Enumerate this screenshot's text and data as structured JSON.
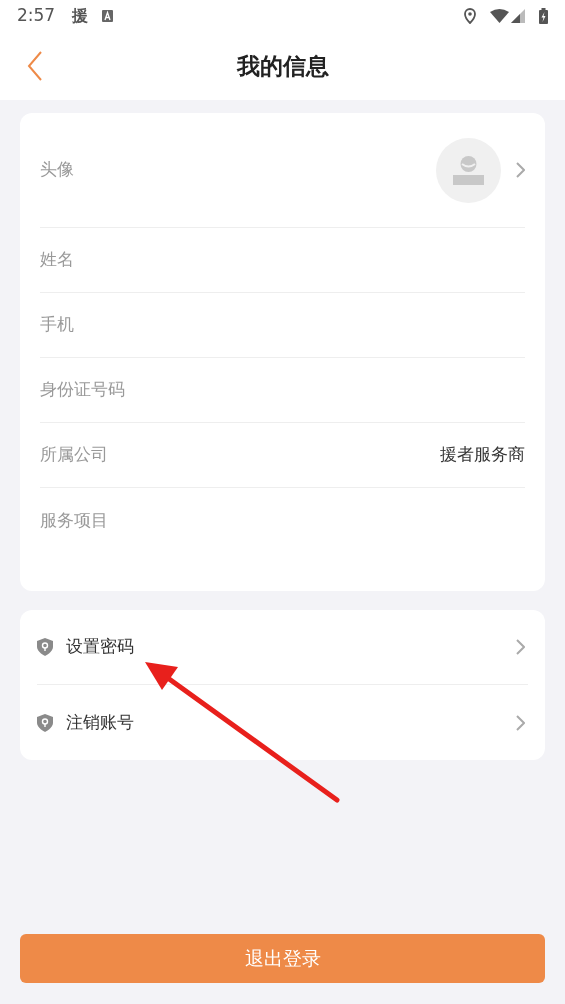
{
  "status_bar": {
    "time": "2:57",
    "app_glyph": "援"
  },
  "header": {
    "title": "我的信息"
  },
  "profile": {
    "avatar_label": "头像",
    "fields": [
      {
        "label": "姓名"
      },
      {
        "label": "手机"
      },
      {
        "label": "身份证号码"
      },
      {
        "label": "所属公司",
        "value": "援者服务商"
      },
      {
        "label": "服务项目"
      }
    ]
  },
  "actions": [
    {
      "label": "设置密码"
    },
    {
      "label": "注销账号"
    }
  ],
  "logout_button": "退出登录"
}
